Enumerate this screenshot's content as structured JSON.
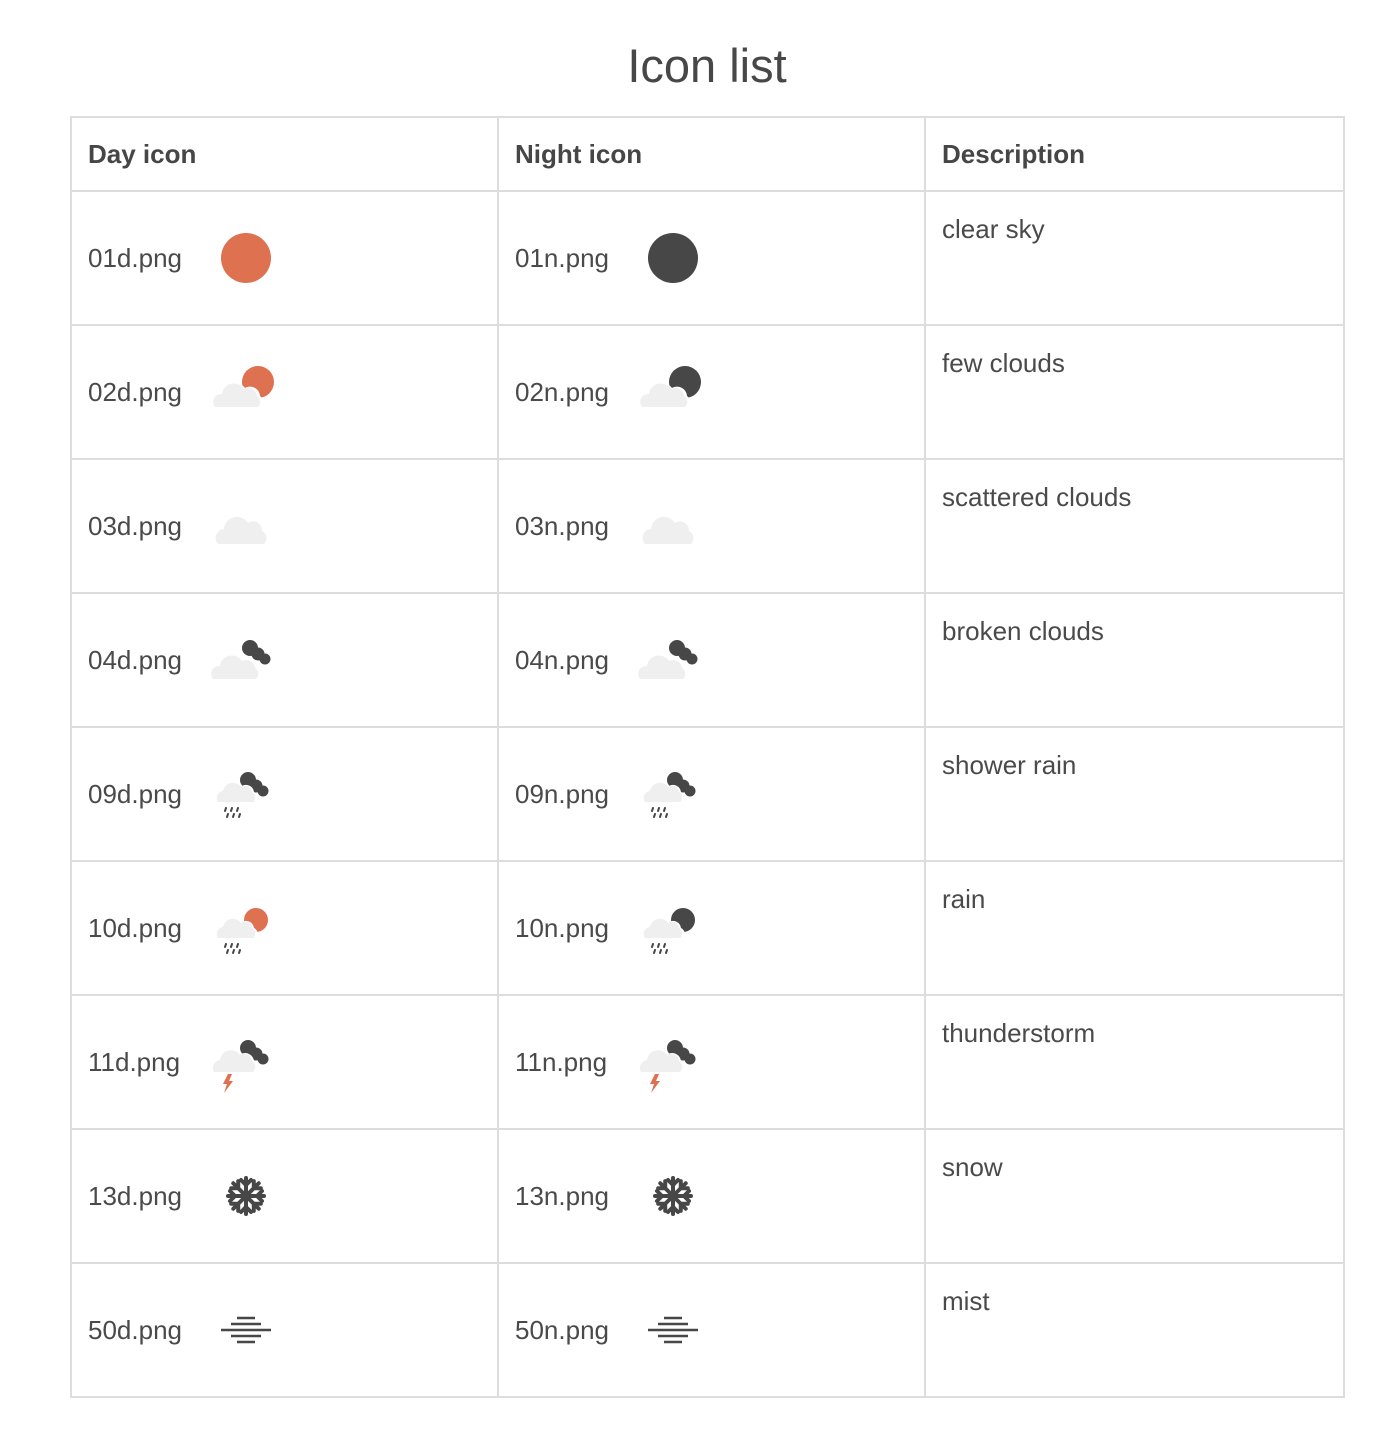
{
  "page": {
    "title": "Icon list"
  },
  "table": {
    "headers": {
      "day": "Day icon",
      "night": "Night icon",
      "description": "Description"
    },
    "rows": [
      {
        "day_file": "01d.png",
        "night_file": "01n.png",
        "description": "clear sky",
        "day_icon": "sun-icon",
        "night_icon": "moon-icon"
      },
      {
        "day_file": "02d.png",
        "night_file": "02n.png",
        "description": "few clouds",
        "day_icon": "cloud-sun-icon",
        "night_icon": "cloud-moon-icon"
      },
      {
        "day_file": "03d.png",
        "night_file": "03n.png",
        "description": "scattered clouds",
        "day_icon": "cloud-icon",
        "night_icon": "cloud-icon"
      },
      {
        "day_file": "04d.png",
        "night_file": "04n.png",
        "description": "broken clouds",
        "day_icon": "dark-clouds-icon",
        "night_icon": "dark-clouds-icon"
      },
      {
        "day_file": "09d.png",
        "night_file": "09n.png",
        "description": "shower rain",
        "day_icon": "shower-rain-icon",
        "night_icon": "shower-rain-icon"
      },
      {
        "day_file": "10d.png",
        "night_file": "10n.png",
        "description": "rain",
        "day_icon": "rain-sun-icon",
        "night_icon": "rain-moon-icon"
      },
      {
        "day_file": "11d.png",
        "night_file": "11n.png",
        "description": "thunderstorm",
        "day_icon": "thunderstorm-icon",
        "night_icon": "thunderstorm-icon"
      },
      {
        "day_file": "13d.png",
        "night_file": "13n.png",
        "description": "snow",
        "day_icon": "snowflake-icon",
        "night_icon": "snowflake-icon"
      },
      {
        "day_file": "50d.png",
        "night_file": "50n.png",
        "description": "mist",
        "day_icon": "mist-icon",
        "night_icon": "mist-icon"
      }
    ]
  },
  "colors": {
    "sun": "#dd7150",
    "dark": "#474747",
    "cloud": "#efefef",
    "border": "#dddddd"
  }
}
